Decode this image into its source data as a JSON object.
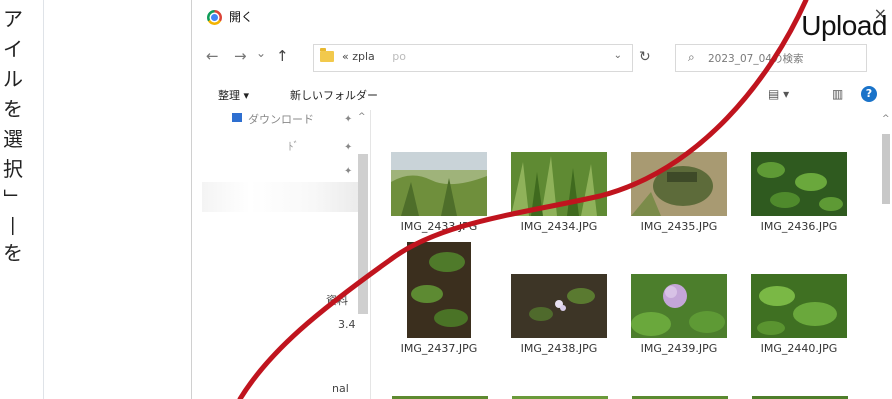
{
  "side_caption": {
    "chars": [
      "ア",
      "イ",
      "ル",
      "を",
      "選",
      "択",
      "」",
      "を"
    ],
    "dash": "—"
  },
  "dialog": {
    "title": "開く",
    "close_glyph": "×",
    "upload_label": "Upload",
    "nav": {
      "back_glyph": "←",
      "forward_glyph": "→",
      "dropdown_glyph": "⌄",
      "up_glyph": "↑",
      "address_prefix": "«",
      "address_text": "zpla",
      "address_tail": "po",
      "address_dropdown": "⌄",
      "refresh_glyph": "↻",
      "search_icon": "⌕",
      "search_placeholder": "2023_07_04の検索"
    },
    "toolbar": {
      "organize": "整理 ▾",
      "new_folder": "新しいフォルダー",
      "view_glyph": "▤ ▾",
      "pane_glyph": "▥",
      "help_glyph": "?"
    },
    "sidebar": {
      "downloads": "ダウンロード",
      "item2": "ﾄﾞ",
      "item_partial": "資料",
      "item_num": "3.4",
      "item_last": "nal",
      "pin": "✦",
      "scroll_up": "^"
    },
    "files": [
      {
        "name": "IMG_2433.JPG"
      },
      {
        "name": "IMG_2434.JPG"
      },
      {
        "name": "IMG_2435.JPG"
      },
      {
        "name": "IMG_2436.JPG"
      },
      {
        "name": "IMG_2437.JPG"
      },
      {
        "name": "IMG_2438.JPG"
      },
      {
        "name": "IMG_2439.JPG"
      },
      {
        "name": "IMG_2440.JPG"
      }
    ],
    "main_scroll_up": "^"
  },
  "colors": {
    "annotation_line": "#c0141e",
    "accent": "#1a73c9",
    "folder": "#f2c94c"
  }
}
